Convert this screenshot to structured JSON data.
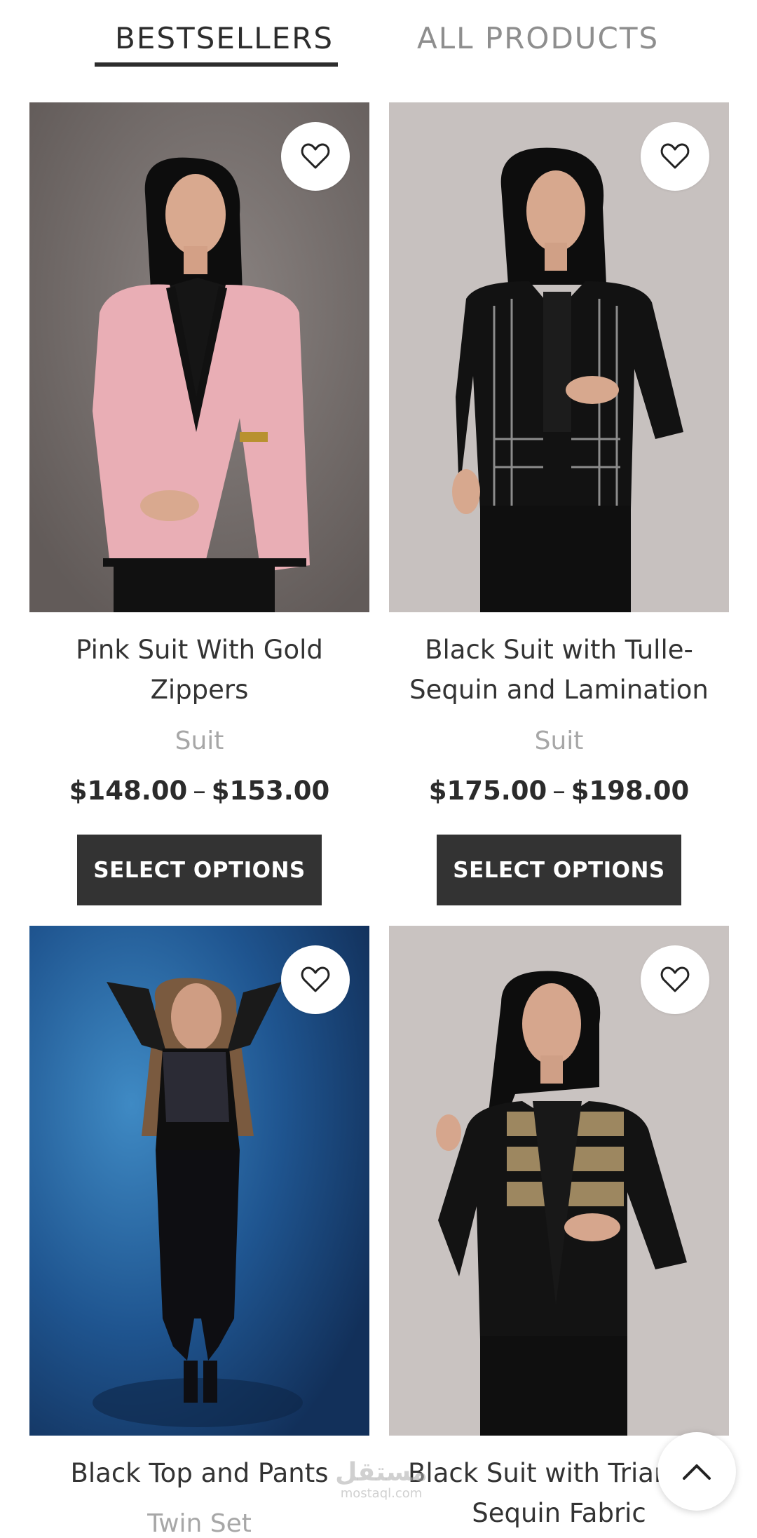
{
  "tabs": {
    "bestsellers": "BESTSELLERS",
    "all_products": "ALL PRODUCTS"
  },
  "products": [
    {
      "title_line1": "Pink Suit With Gold",
      "title_line2": "Zippers",
      "category": "Suit",
      "price_min": "$148.00",
      "price_max": "$153.00",
      "button": "SELECT OPTIONS"
    },
    {
      "title_line1": "Black Suit with Tulle-",
      "title_line2": "Sequin and Lamination",
      "category": "Suit",
      "price_min": "$175.00",
      "price_max": "$198.00",
      "button": "SELECT OPTIONS"
    },
    {
      "title_line1": "Black Top and Pants",
      "category": "Twin Set"
    },
    {
      "title_line1": "Black Suit with Triangle",
      "title_line2": "Sequin Fabric"
    }
  ],
  "price_separator": "–",
  "watermark": {
    "arabic": "مستقل",
    "latin": "mostaql.com"
  },
  "icons": {
    "wishlist": "heart-icon",
    "scroll_top": "chevron-up-icon"
  },
  "colors": {
    "button_bg": "#333333",
    "active_tab": "#2d2d2d",
    "inactive_tab": "#8e8e8e",
    "category_text": "#a7a7a7"
  }
}
